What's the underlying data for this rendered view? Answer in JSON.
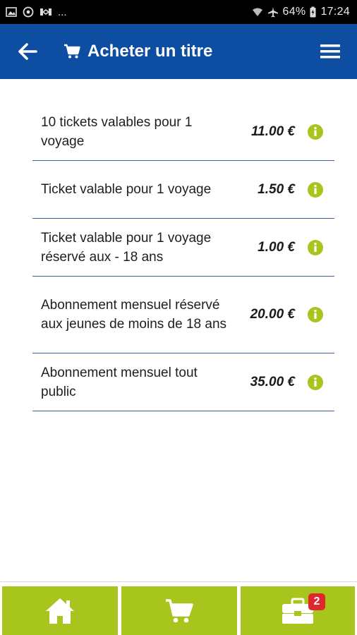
{
  "status_bar": {
    "battery": "64%",
    "time": "17:24",
    "more_indicator": "..."
  },
  "header": {
    "title": "Acheter un titre",
    "icons": {
      "back": "arrow-left-icon",
      "title": "cart-icon",
      "menu": "hamburger-menu-icon"
    }
  },
  "tickets": [
    {
      "label": "10 tickets valables pour 1 voyage",
      "price": "11.00 €"
    },
    {
      "label": "Ticket valable pour 1 voyage",
      "price": "1.50 €"
    },
    {
      "label": "Ticket valable pour 1 voyage réservé aux - 18 ans",
      "price": "1.00 €"
    },
    {
      "label": "Abonnement mensuel réservé aux jeunes de moins de 18 ans",
      "price": "20.00 €"
    },
    {
      "label": "Abonnement mensuel tout public",
      "price": "35.00 €"
    }
  ],
  "bottom_nav": {
    "items": [
      "home-icon",
      "cart-icon",
      "toolbox-icon"
    ],
    "badge": "2"
  },
  "colors": {
    "app_bar": "#0d4ea2",
    "nav_button": "#a8c51d",
    "info_icon": "#a8c51d",
    "badge": "#e0272c",
    "divider": "#3f5ea8"
  }
}
